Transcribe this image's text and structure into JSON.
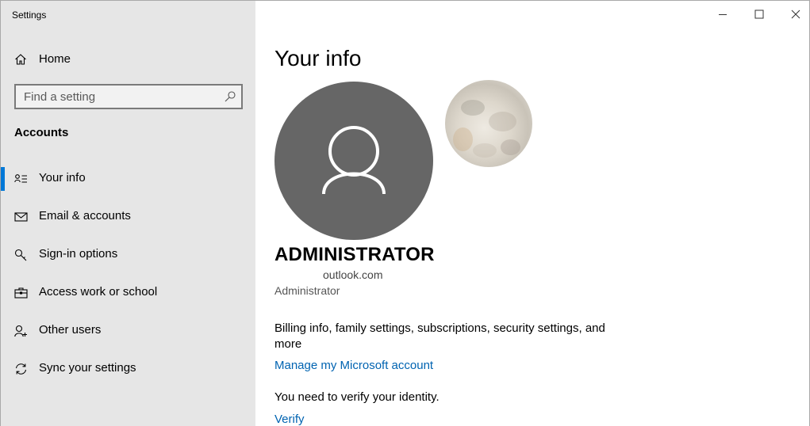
{
  "window": {
    "title": "Settings"
  },
  "sidebar": {
    "home_label": "Home",
    "search_placeholder": "Find a setting",
    "section_title": "Accounts",
    "items": [
      {
        "label": "Your info",
        "icon": "person-card-icon",
        "active": true
      },
      {
        "label": "Email & accounts",
        "icon": "mail-icon",
        "active": false
      },
      {
        "label": "Sign-in options",
        "icon": "key-icon",
        "active": false
      },
      {
        "label": "Access work or school",
        "icon": "briefcase-icon",
        "active": false
      },
      {
        "label": "Other users",
        "icon": "person-add-icon",
        "active": false
      },
      {
        "label": "Sync your settings",
        "icon": "sync-icon",
        "active": false
      }
    ]
  },
  "main": {
    "title": "Your info",
    "user_name": "ADMINISTRATOR",
    "email": "outlook.com",
    "role": "Administrator",
    "billing_text": "Billing info, family settings, subscriptions, security settings, and more",
    "manage_link": "Manage my Microsoft account",
    "verify_text": "You need to verify your identity.",
    "verify_link": "Verify"
  },
  "colors": {
    "accent": "#0078d7",
    "link": "#0063b1",
    "sidebar_bg": "#e6e6e6",
    "avatar_bg": "#666666"
  }
}
